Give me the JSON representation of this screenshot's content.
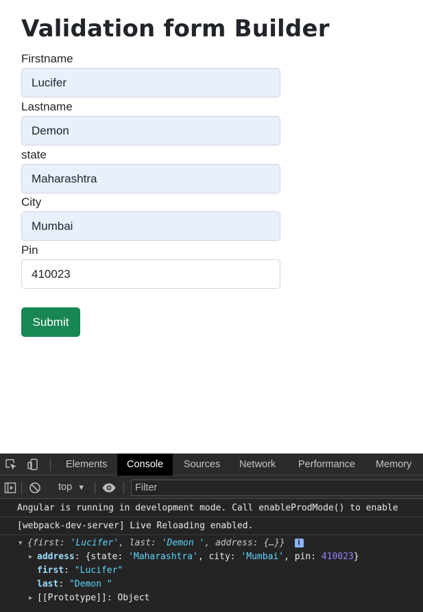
{
  "form": {
    "title": "Validation form Builder",
    "fields": [
      {
        "label": "Firstname",
        "value": "Lucifer"
      },
      {
        "label": "Lastname",
        "value": "Demon"
      },
      {
        "label": "state",
        "value": "Maharashtra"
      },
      {
        "label": "City",
        "value": "Mumbai"
      },
      {
        "label": "Pin",
        "value": "410023"
      }
    ],
    "submit_label": "Submit",
    "colors": {
      "autofill_bg": "#e8f0fe",
      "submit_bg": "#198754"
    }
  },
  "devtools": {
    "tabs": [
      "Elements",
      "Console",
      "Sources",
      "Network",
      "Performance",
      "Memory"
    ],
    "active_tab": "Console",
    "context_select": "top",
    "filter_placeholder": "Filter",
    "icons": [
      "inspect-element-icon",
      "device-toolbar-icon",
      "sidebar-toggle-icon",
      "clear-console-icon",
      "eye-icon"
    ],
    "messages": [
      "Angular is running in development mode. Call enableProdMode() to enable",
      "[webpack-dev-server] Live Reloading enabled."
    ],
    "object_log": {
      "summary": {
        "open": "{",
        "k1": "first",
        "v1": "'Lucifer'",
        "k2": "last",
        "v2": "'Demon  '",
        "k3": "address",
        "v3": "{…}",
        "close": "}",
        "badge": "i"
      },
      "address_row": {
        "key": "address",
        "open": "{",
        "k1": "state",
        "v1": "'Maharashtra'",
        "k2": "city",
        "v2": "'Mumbai'",
        "k3": "pin",
        "v3": "410023",
        "close": "}"
      },
      "first_row": {
        "key": "first",
        "value": "\"Lucifer\""
      },
      "last_row": {
        "key": "last",
        "value": "\"Demon  \""
      },
      "prototype_row": {
        "key": "[[Prototype]]",
        "value": "Object"
      }
    }
  }
}
